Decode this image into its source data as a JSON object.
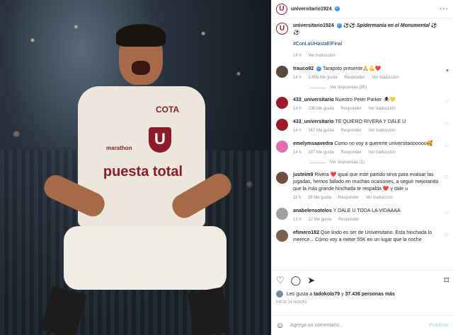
{
  "post": {
    "account": "universitario1924",
    "caption_user": "universitario1924",
    "caption_text": "⚽⚽ Spidermanía en el Monumental ⚽⚽",
    "hashtag": "#ConLaUHastaElFinal",
    "caption_time": "14 h",
    "see_translation": "Ver traducción",
    "photo": {
      "crest_letter": "U",
      "sponsor": "puesta total",
      "brand": "COTA",
      "kit": "marathon"
    }
  },
  "comments": [
    {
      "user": "trauco92",
      "verified": true,
      "text": "Tarapoto presente🙏💪❤️",
      "time": "14 h",
      "likes": "2,459 Me gusta",
      "reply": "Responder",
      "translate": "Ver traducción",
      "liked": true,
      "avatar_color": "#5b4a3a",
      "replies": "Ver respuestas (95)"
    },
    {
      "user": "433_universitario",
      "verified": false,
      "text": "Nuestro Peter Parker 🕷💛",
      "time": "14 h",
      "likes": "135 Me gusta",
      "reply": "Responder",
      "translate": "Ver traducción",
      "liked": false,
      "avatar_color": "#9b1b2b"
    },
    {
      "user": "433_universitario",
      "verified": false,
      "text": "TE QUIERO RIVERA Y DALE U",
      "time": "14 h",
      "likes": "167 Me gusta",
      "reply": "Responder",
      "translate": "Ver traducción",
      "liked": false,
      "avatar_color": "#9b1b2b"
    },
    {
      "user": "emelymsaavedra",
      "verified": false,
      "text": "Como no voy a quererte universitariooooo🥰",
      "time": "14 h",
      "likes": "107 Me gusta",
      "reply": "Responder",
      "translate": "Ver traducción",
      "liked": false,
      "avatar_color": "#e070a8",
      "replies": "Ver respuestas (1)"
    },
    {
      "user": "justeim9",
      "verified": false,
      "text": "Rivera ❤️ igual que este partido sirva para evaluar las jugadas, hemos fallado en muchas ocasiones, a seguir mejorando que la más grande hinchada te respalda ❤️ y dale u",
      "time": "11 h",
      "likes": "28 Me gusta",
      "reply": "Responder",
      "translate": "Ver traducción",
      "liked": false,
      "avatar_color": "#6b5040"
    },
    {
      "user": "anabelensotelos",
      "verified": false,
      "text": "Y DALE U TODA LA VIDAAAA",
      "time": "13 h",
      "likes": "12 Me gusta",
      "reply": "Responder",
      "translate": "",
      "liked": false,
      "avatar_color": "#a0a0a0"
    },
    {
      "user": "efimero182",
      "verified": false,
      "text": "Que lindo es ser de Universitario. Esta hinchada lo merece... Cómo voy a meter 55K en un lugar que la noche",
      "time": "",
      "likes": "",
      "reply": "",
      "translate": "",
      "liked": false,
      "avatar_color": "#7a6050"
    }
  ],
  "footer": {
    "liked_by_prefix": "Les gusta a",
    "liked_by_user": "tadokolo79",
    "liked_by_suffix": "y",
    "liked_by_count": "37.436 personas más",
    "timestamp": "HACE 14 HORAS",
    "comment_placeholder": "Agrega un comentario...",
    "publish": "Publicar"
  },
  "icons": {
    "like": "heart-icon",
    "comment": "comment-icon",
    "share": "share-icon",
    "save": "bookmark-icon",
    "emoji": "emoji-icon",
    "more": "more-icon"
  },
  "colors": {
    "brand": "#9b1b2b",
    "like_red": "#ed4956",
    "link": "#00376b",
    "verified": "#3897f0",
    "muted": "#8e8e8e"
  }
}
